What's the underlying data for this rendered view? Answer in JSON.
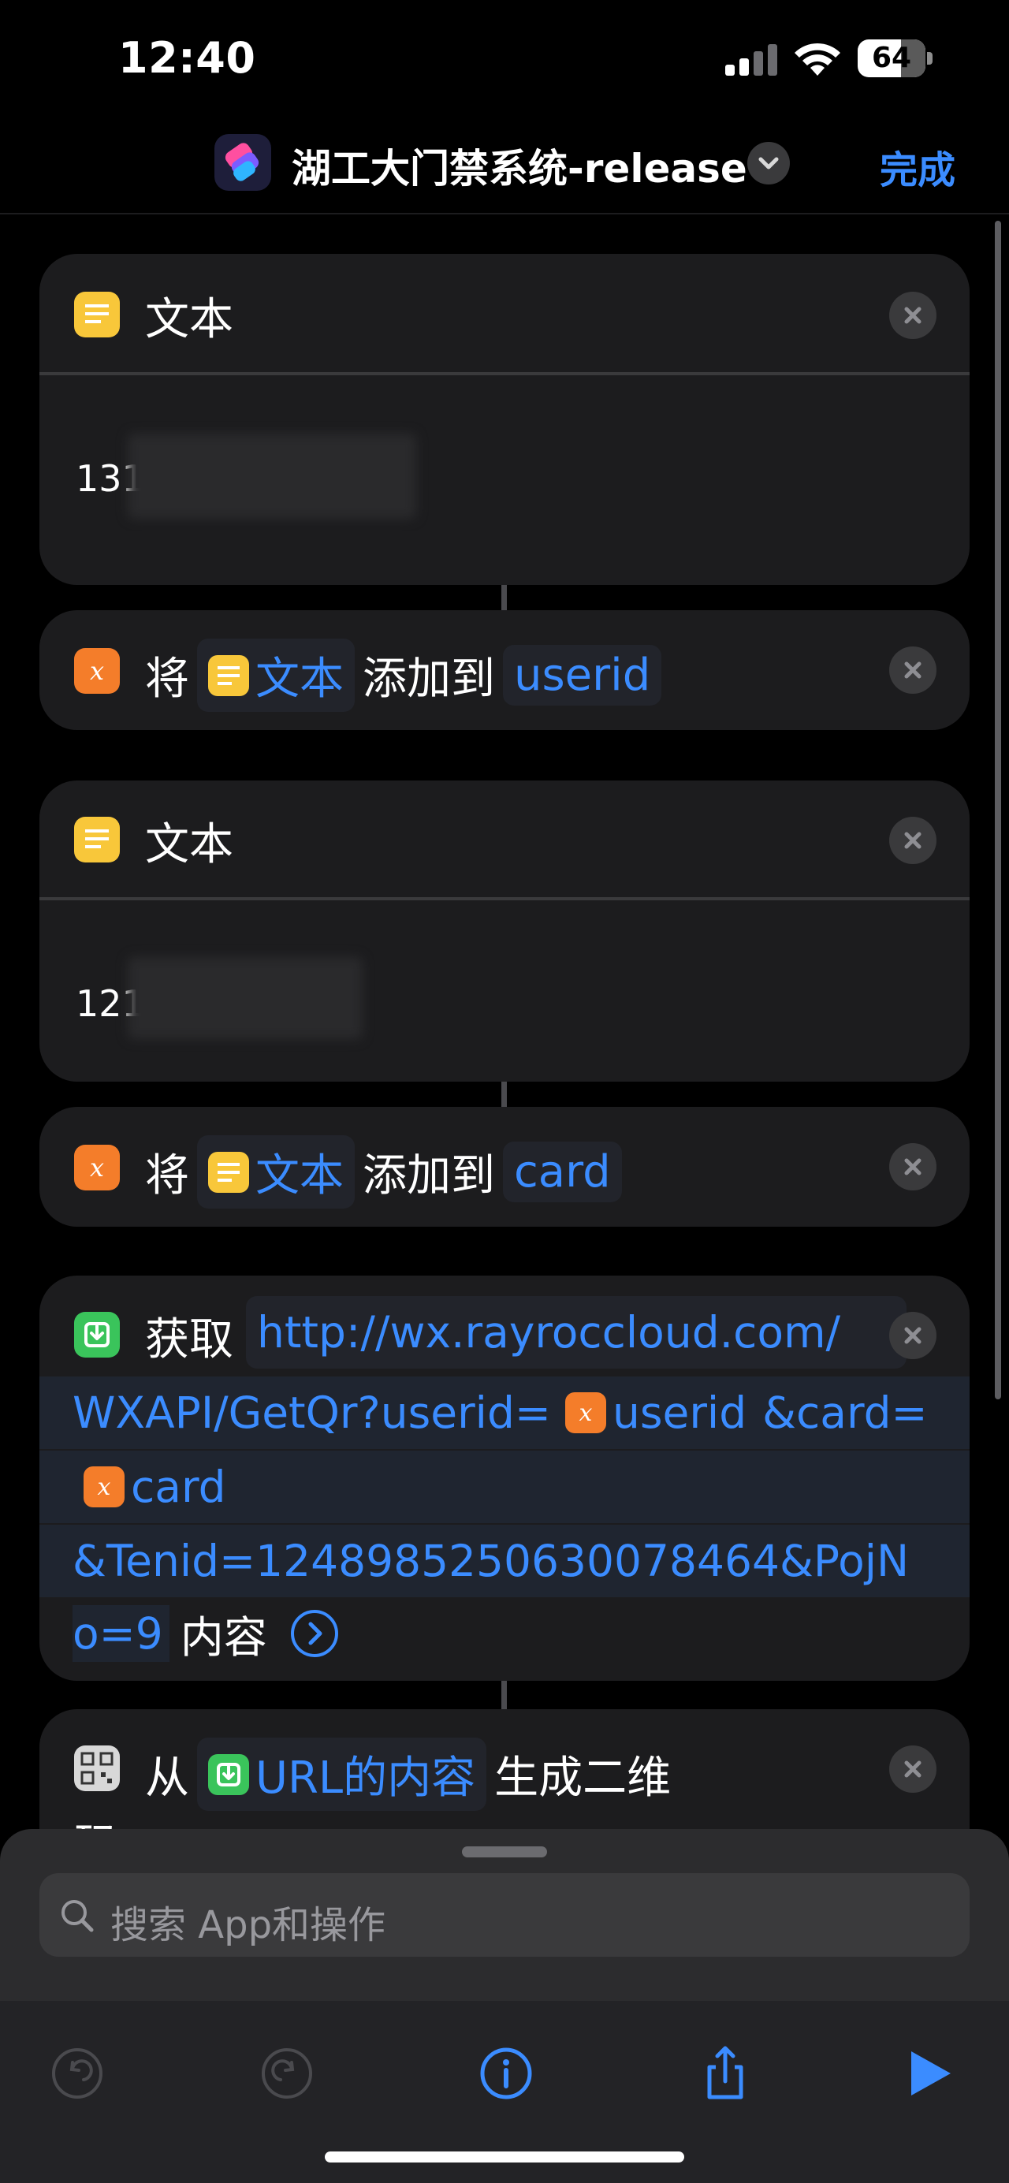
{
  "status_bar": {
    "time": "12:40",
    "battery_percent": "64",
    "battery_level": 0.64
  },
  "nav": {
    "title": "湖工大门禁系统-release",
    "done_label": "完成"
  },
  "actions": {
    "text1": {
      "title": "文本",
      "value_visible": "131"
    },
    "add1": {
      "verb": "将",
      "token_label": "文本",
      "middle": "添加到",
      "target": "userid"
    },
    "text2": {
      "title": "文本",
      "value_visible": "121"
    },
    "add2": {
      "verb": "将",
      "token_label": "文本",
      "middle": "添加到",
      "target": "card"
    },
    "get": {
      "verb": "获取",
      "url_line1": "http://wx.rayroccloud.com/",
      "url_line2_prefix": "WXAPI/GetQr?userid=",
      "url_line2_var": "userid",
      "url_line2_suffix": "&card=",
      "url_line3_var": "card",
      "url_line4": "&Tenid=1248985250630078464&PojN",
      "url_line5": "o=9",
      "object": "内容"
    },
    "qr": {
      "verb": "从",
      "token_label": "URL的内容",
      "suffix": "生成二维",
      "wrap_char": "码"
    }
  },
  "sheet": {
    "search_placeholder": "搜索 App和操作"
  },
  "colors": {
    "accent": "#3b8cff",
    "card": "#1c1c1e",
    "yellow": "#f8c73a",
    "orange": "#f47d2a",
    "green": "#3ac45b"
  },
  "icons": [
    "text-icon",
    "variable-icon",
    "download-icon",
    "qr-code-icon",
    "close-icon",
    "undo-icon",
    "redo-icon",
    "info-icon",
    "share-icon",
    "play-icon",
    "search-icon"
  ]
}
